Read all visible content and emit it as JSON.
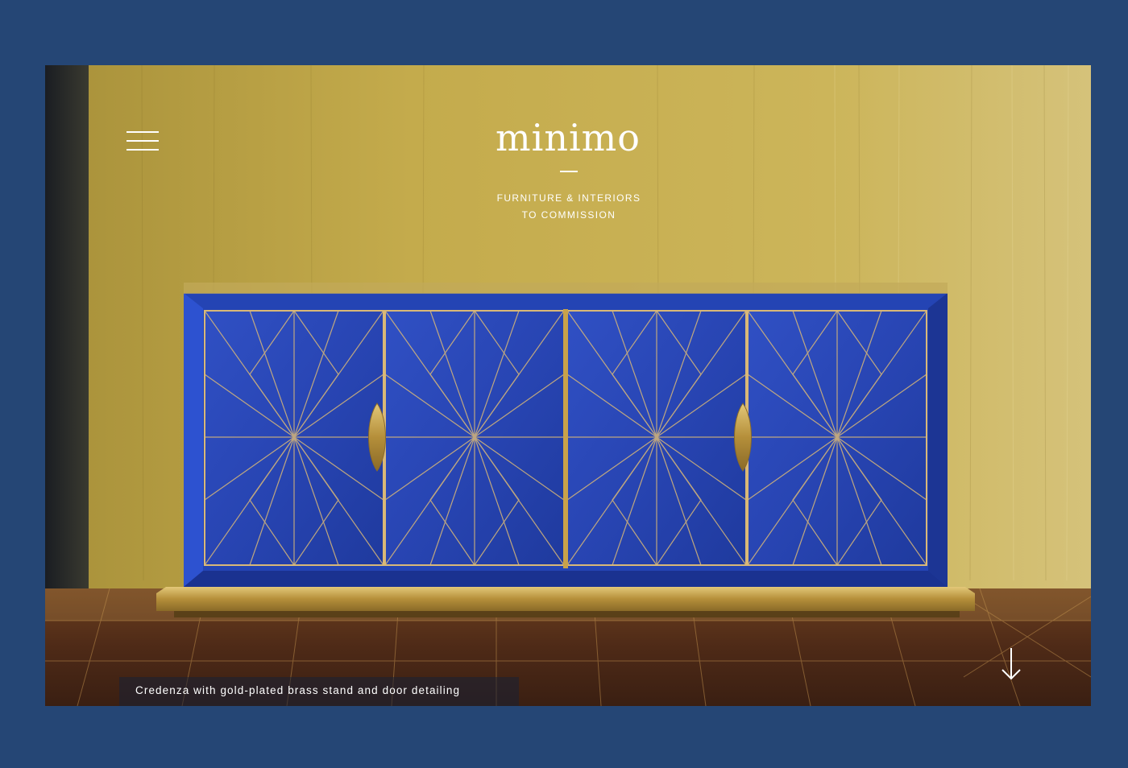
{
  "header": {
    "logo": "minimo",
    "tagline_line1": "FURNITURE & INTERIORS",
    "tagline_line2": "TO COMMISSION"
  },
  "hero": {
    "caption": "Credenza with gold-plated brass stand and door detailing",
    "image_subject": "Blue credenza with gold starburst inlay on brass plinth against gold wall"
  },
  "icons": {
    "menu": "hamburger-icon",
    "scroll": "arrow-down-icon"
  },
  "colors": {
    "page_background": "#254675",
    "wall_gold": "#c4ab4c",
    "cabinet_blue": "#2748b8",
    "brass": "#c9a24a",
    "text": "#ffffff"
  }
}
